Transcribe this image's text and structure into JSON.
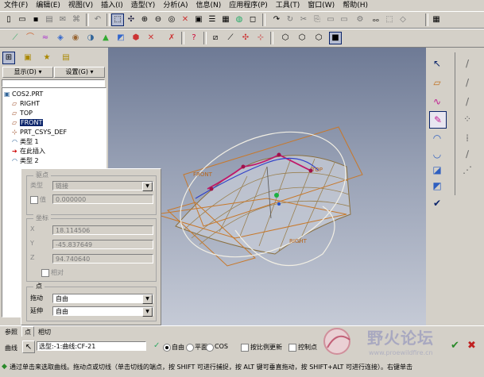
{
  "menu": [
    "文件(F)",
    "编辑(E)",
    "视图(V)",
    "插入(I)",
    "造型(Y)",
    "分析(A)",
    "信息(N)",
    "应用程序(P)",
    "工具(T)",
    "窗口(W)",
    "帮助(H)"
  ],
  "nav": {
    "display_label": "显示(D) ▾",
    "settings_label": "设置(G) ▾"
  },
  "tree": [
    {
      "label": "COS2.PRT",
      "icon": "part-icon"
    },
    {
      "label": "RIGHT",
      "icon": "datum-plane-icon"
    },
    {
      "label": "TOP",
      "icon": "datum-plane-icon"
    },
    {
      "label": "FRONT",
      "icon": "datum-plane-icon"
    },
    {
      "label": "PRT_CSYS_DEF",
      "icon": "csys-icon"
    },
    {
      "label": "类型 1",
      "icon": "style-feature-icon"
    },
    {
      "label": "在此插入",
      "icon": "insert-here-icon"
    },
    {
      "label": "类型 2",
      "icon": "style-feature-icon"
    }
  ],
  "panel": {
    "drive_point": {
      "title": "驱点",
      "type_label": "类型",
      "type_value": "链接",
      "value_label": "值",
      "value": "0.000000"
    },
    "coords": {
      "title": "坐标",
      "x_label": "X",
      "x_value": "18.114506",
      "y_label": "Y",
      "y_value": "-45.837649",
      "z_label": "Z",
      "z_value": "94.740640",
      "relative_label": "相对"
    },
    "point": {
      "title": "点",
      "drag_label": "拖动",
      "drag_value": "自由",
      "extend_label": "延伸",
      "extend_value": "自由"
    }
  },
  "tabs": [
    "参照",
    "点",
    "相切"
  ],
  "dashboard": {
    "curve_label": "曲线",
    "selected_value": "选型:-1:曲线:CF-21",
    "radio_free": "自由",
    "radio_plane": "平面",
    "radio_cos": "COS",
    "proportional_label": "按比例更新",
    "control_point_label": "控制点"
  },
  "viewport_labels": {
    "front": "FRONT",
    "top": "TOP",
    "right": "RIGHT"
  },
  "status_text": "通过单击来选取曲线。拖动点或切线（单击切线的端点，按 SHIFT 可进行捕捉，按 ALT 键可垂直拖动，按 SHIFT+ALT 可进行连接）。右键单击",
  "watermark": {
    "title": "野火论坛",
    "url": "www.proewildfire.cn"
  },
  "colors": {
    "viewport_top": "#6e7a95",
    "viewport_bottom": "#c5cad6",
    "accent": "#0a246a"
  }
}
